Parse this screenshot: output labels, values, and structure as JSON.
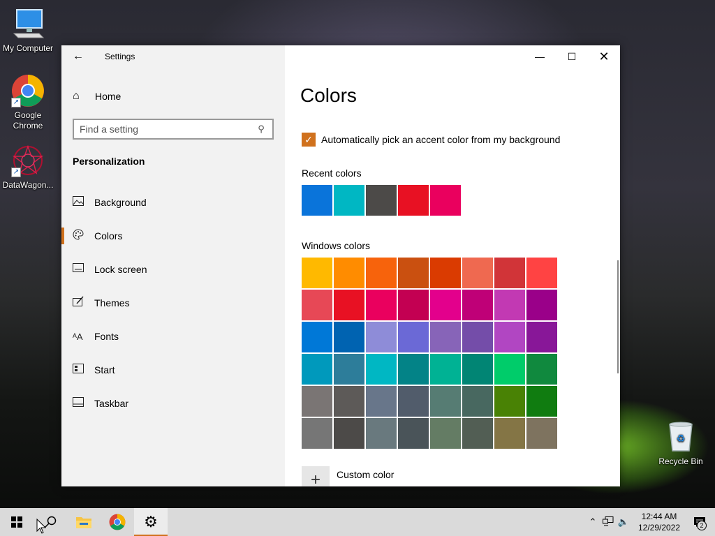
{
  "desktop": {
    "icons": [
      {
        "name": "my-computer",
        "label": "My Computer"
      },
      {
        "name": "google-chrome",
        "label": "Google Chrome"
      },
      {
        "name": "datawagon",
        "label": "DataWagon..."
      },
      {
        "name": "recycle-bin",
        "label": "Recycle Bin"
      }
    ]
  },
  "window": {
    "app_title": "Settings",
    "home_label": "Home",
    "search_placeholder": "Find a setting",
    "section_title": "Personalization",
    "nav": [
      {
        "label": "Background",
        "icon": "image-icon"
      },
      {
        "label": "Colors",
        "icon": "palette-icon",
        "active": true
      },
      {
        "label": "Lock screen",
        "icon": "lock-screen-icon"
      },
      {
        "label": "Themes",
        "icon": "themes-icon"
      },
      {
        "label": "Fonts",
        "icon": "fonts-icon"
      },
      {
        "label": "Start",
        "icon": "start-icon"
      },
      {
        "label": "Taskbar",
        "icon": "taskbar-icon"
      }
    ]
  },
  "content": {
    "title": "Colors",
    "auto_accent_label": "Automatically pick an accent color from my background",
    "auto_accent_checked": true,
    "recent_colors_label": "Recent colors",
    "recent_colors": [
      "#0a74da",
      "#00b7c3",
      "#4c4a48",
      "#e81123",
      "#ea005e"
    ],
    "windows_colors_label": "Windows colors",
    "windows_colors": [
      "#ffb900",
      "#ff8c00",
      "#f7630c",
      "#ca5010",
      "#da3b01",
      "#ef6950",
      "#d13438",
      "#ff4343",
      "#e74856",
      "#e81123",
      "#ea005e",
      "#c30052",
      "#e3008c",
      "#bf0077",
      "#c239b3",
      "#9a0089",
      "#0078d7",
      "#0063b1",
      "#8e8cd8",
      "#6b69d6",
      "#8764b8",
      "#744da9",
      "#b146c2",
      "#881798",
      "#0099bc",
      "#2d7d9a",
      "#00b7c3",
      "#038387",
      "#00b294",
      "#018574",
      "#00cc6a",
      "#10893e",
      "#7a7574",
      "#5d5a58",
      "#68768a",
      "#515c6b",
      "#567c73",
      "#486860",
      "#498205",
      "#107c10",
      "#767676",
      "#4c4a48",
      "#69797e",
      "#4a5459",
      "#647c64",
      "#525e54",
      "#847545",
      "#7e735f"
    ],
    "custom_color_label": "Custom color"
  },
  "taskbar": {
    "time": "12:44 AM",
    "date": "12/29/2022",
    "notification_count": "2"
  },
  "colors": {
    "accent": "#d0711d"
  }
}
